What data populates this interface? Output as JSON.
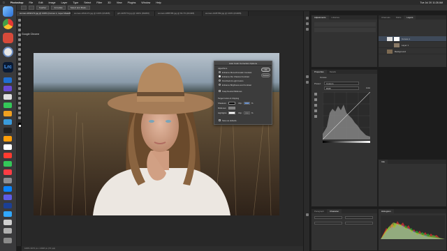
{
  "menubar": {
    "app": "Photoshop",
    "items": [
      "File",
      "Edit",
      "Image",
      "Layer",
      "Type",
      "Select",
      "Filter",
      "3D",
      "View",
      "Plugins",
      "Window",
      "Help"
    ],
    "clock": "Tue Jul 20 11:28 AM"
  },
  "window_title": "Adobe Photoshop 2021",
  "options": {
    "select_label": "Select",
    "button1": "Feather",
    "button2": "Anti-alias",
    "button3": "Select and Mask..."
  },
  "tabs": [
    {
      "label": "woman-1844172.jpg @ 100% (Curves 1, Layer Mask/8)",
      "active": true
    },
    {
      "label": "woman-1844172.jpg @ 100% (RGB/8)",
      "active": false
    },
    {
      "label": "girl-4165772.jpg @ 100% (RGB/8)",
      "active": false
    },
    {
      "label": "woman-1885785.jpg @ 66.7% (RGB/8)",
      "active": false
    },
    {
      "label": "woman-1935789.jpg @ 100% (RGB/8)",
      "active": false
    }
  ],
  "chrome_label": "Google Chrome",
  "dialog": {
    "title": "Auto Color Correction Options",
    "algorithms_label": "Algorithms",
    "options": [
      {
        "label": "Enhance Monochromatic Contrast",
        "selected": false
      },
      {
        "label": "Enhance Per Channel Contrast",
        "selected": true
      },
      {
        "label": "Find Dark & Light Colors",
        "selected": false
      },
      {
        "label": "Enhance Brightness and Contrast",
        "selected": false
      }
    ],
    "snap_label": "Snap Neutral Midtones",
    "target_label": "Target Colors & Clipping",
    "shadows_label": "Shadows:",
    "midtones_label": "Midtones:",
    "highlights_label": "Highlights:",
    "clip_label": "Clip:",
    "shadows_clip": "0.10",
    "highlights_clip": "0.10",
    "percent": "%",
    "save_label": "Save as defaults",
    "ok_label": "OK",
    "cancel_label": "Cancel"
  },
  "panels": {
    "adjust_tabs": [
      "Adjustments",
      "Libraries"
    ],
    "layer_tabs": [
      "Channels",
      "Paths",
      "Layers"
    ],
    "layers": [
      {
        "name": "Curves 1"
      },
      {
        "name": "Layer 1"
      },
      {
        "name": "Background"
      }
    ],
    "properties_tabs": [
      "Properties",
      "Details"
    ],
    "properties_title": "Curves",
    "preset_label": "Preset:",
    "preset_value": "Custom",
    "channel_value": "RGB",
    "auto_label": "Auto",
    "info_tab": "Info",
    "paragraph_tabs": [
      "Paragraph",
      "Character"
    ],
    "histogram_tab": "Histogram"
  },
  "status_text": "100%   3072 px x 2048 px (72 ppi)",
  "colors": {
    "dialog_bg": "#3c3c3c",
    "accent": "#2a5fb0"
  }
}
